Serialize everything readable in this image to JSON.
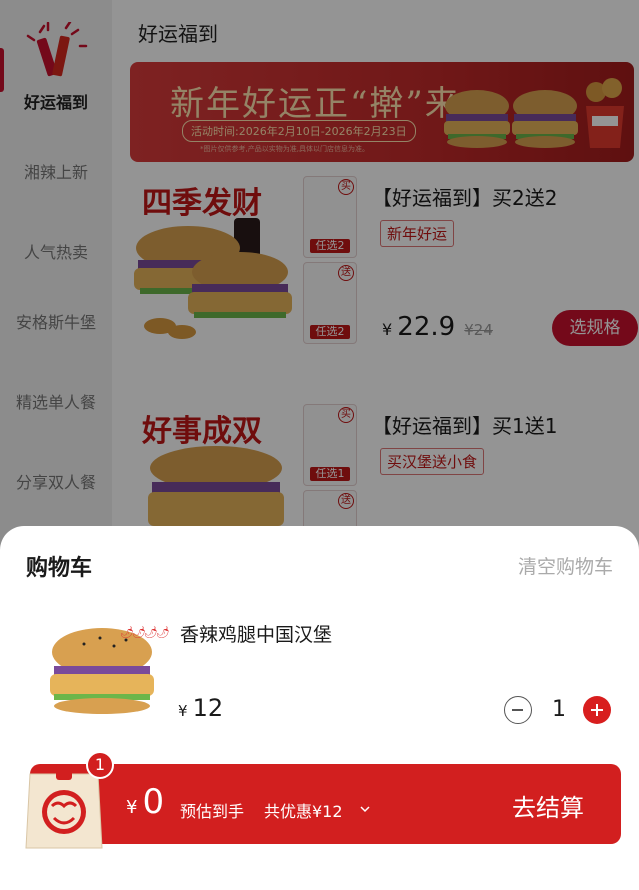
{
  "sidebar": {
    "items": [
      {
        "label": "好运福到",
        "active": true
      },
      {
        "label": "湘辣上新"
      },
      {
        "label": "人气热卖"
      },
      {
        "label": "安格斯牛堡"
      },
      {
        "label": "精选单人餐"
      },
      {
        "label": "分享双人餐"
      }
    ]
  },
  "main": {
    "section_title": "好运福到",
    "banner": {
      "title": "新年好运正“擀”来",
      "date": "活动时间:2026年2月10日-2026年2月23日",
      "note": "*图片仅供参考,产品以实物为准,具体以门店信息为准。"
    },
    "products": [
      {
        "image_title": "四季发财",
        "name": "【好运福到】买2送2",
        "tag": "新年好运",
        "currency": "¥",
        "price": "22.9",
        "old_price": "¥24",
        "spec_button": "选规格",
        "choices": [
          {
            "tag": "买",
            "label": "任选2"
          },
          {
            "tag": "送",
            "label": "任选2"
          }
        ]
      },
      {
        "image_title": "好事成双",
        "name": "【好运福到】买1送1",
        "tag": "买汉堡送小食",
        "choices": [
          {
            "tag": "买",
            "label": "任选1"
          },
          {
            "tag": "送",
            "label": ""
          }
        ]
      }
    ]
  },
  "cart": {
    "title": "购物车",
    "clear_label": "清空购物车",
    "items": [
      {
        "name": "香辣鸡腿中国汉堡",
        "currency": "¥",
        "price": "12",
        "quantity": "1"
      }
    ]
  },
  "checkout": {
    "badge_count": "1",
    "currency": "¥",
    "total": "0",
    "est_label": "预估到手",
    "discount": "共优惠¥12",
    "button_label": "去结算"
  },
  "colors": {
    "brand_red": "#d21f1f",
    "overlay": "rgba(0,0,0,0.42)"
  }
}
